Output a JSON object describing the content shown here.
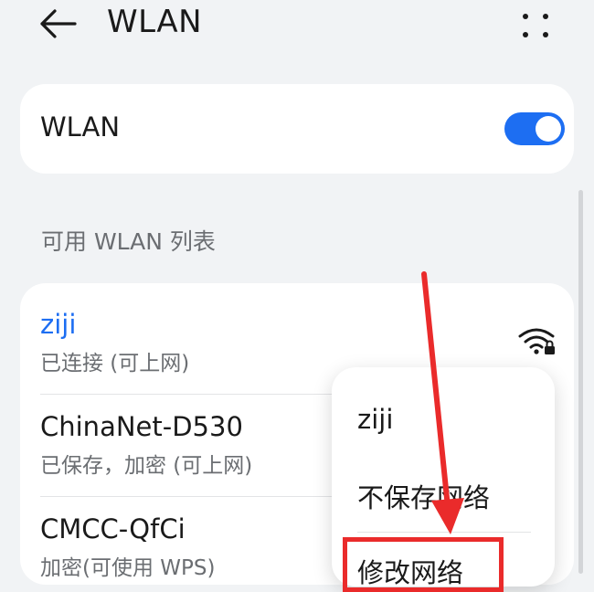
{
  "header": {
    "back_icon": "arrow-left-icon",
    "title": "WLAN",
    "more_icon": "more-vertical-icon"
  },
  "wlan_toggle": {
    "label": "WLAN",
    "enabled": true,
    "color": "#1d6ef2"
  },
  "section_title": "可用 WLAN 列表",
  "networks": [
    {
      "name": "ziji",
      "status": "已连接 (可上网)",
      "connected": true,
      "icon": "wifi-locked-icon"
    },
    {
      "name": "ChinaNet-D530",
      "status": "已保存，加密 (可上网)"
    },
    {
      "name": "CMCC-QfCi",
      "status": "加密(可使用 WPS)"
    }
  ],
  "popup": {
    "title": "ziji",
    "items": [
      "不保存网络",
      "修改网络"
    ]
  },
  "annotation": {
    "arrow_color": "#ea2b2b"
  }
}
